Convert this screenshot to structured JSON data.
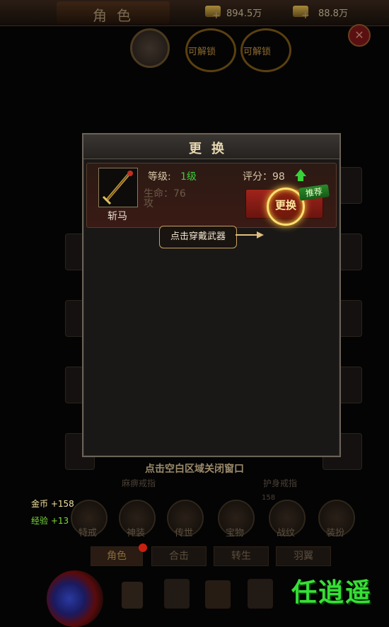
{
  "header": {
    "title": "角色",
    "currency1": {
      "plus": "+",
      "value": "894.5万"
    },
    "currency2": {
      "plus": "+",
      "value": "88.8万"
    }
  },
  "background": {
    "unlock_label_1": "可解锁",
    "unlock_label_2": "可解锁",
    "ring_names": [
      "麻痹戒指",
      "护身戒指"
    ],
    "skill_count": "158",
    "skills": [
      "特戒",
      "神装",
      "传世",
      "宝物",
      "战纹",
      "装扮"
    ],
    "tabs": [
      "角色",
      "合击",
      "转生",
      "羽翼"
    ]
  },
  "dialog": {
    "title": "更换",
    "item": {
      "name": "斩马",
      "level_label": "等级:",
      "level_value": "1级",
      "score_label": "评分：98",
      "stat_partial_1": "生命：76",
      "stat_partial_2": "攻",
      "change_button": "更换",
      "recommend_badge": "推荐"
    },
    "tooltip": "点击穿戴武器"
  },
  "hint": "点击空白区域关闭窗口",
  "rewards": {
    "gold_label": "金币",
    "gold_value": "+158",
    "exp_label": "经验",
    "exp_value": "+13"
  },
  "watermark": "任逍遥",
  "colors": {
    "accent_gold": "#ffd040",
    "level_green": "#3ad03a",
    "button_red": "#a0241c",
    "watermark_green": "#36e036"
  }
}
